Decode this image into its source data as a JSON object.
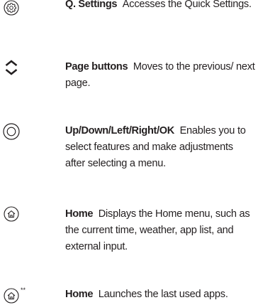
{
  "entries": [
    {
      "icon": "quick-settings-gear-icon",
      "title": "Q. Settings",
      "text": "Accesses the Quick Settings."
    },
    {
      "icon": "page-up-down-chevrons-icon",
      "title": "Page buttons",
      "text": "Moves to the previous/ next page."
    },
    {
      "icon": "wheel-ok-ring-icon",
      "title": "Up/Down/Left/Right/OK",
      "text": "Enables you to select features and make adjustments after selecting a menu."
    },
    {
      "icon": "home-icon",
      "title": "Home",
      "text": "Displays the Home menu, such as the current time, weather, app list, and external input."
    },
    {
      "icon": "home-long-press-icon",
      "icon_mark": "**",
      "title": "Home",
      "text": "Launches the last used apps."
    }
  ]
}
